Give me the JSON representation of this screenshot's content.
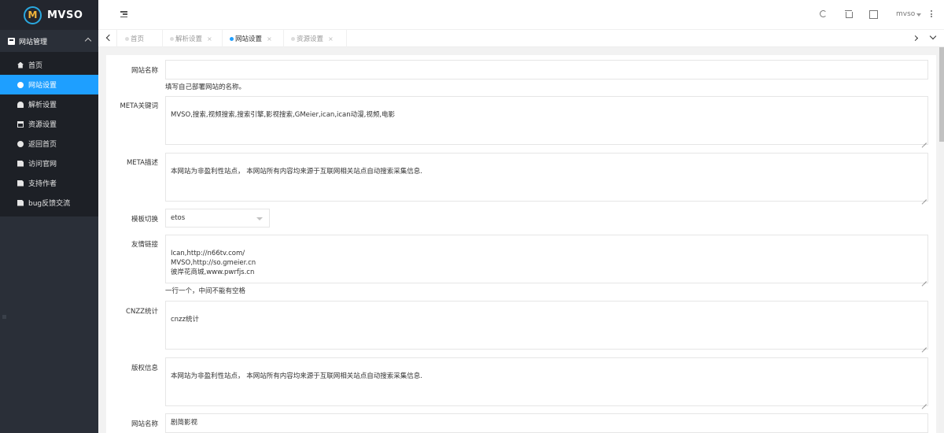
{
  "brand": {
    "logo_letter": "M",
    "name": "MVSO"
  },
  "sidebar": {
    "group": "网站管理",
    "items": [
      {
        "label": "首页",
        "icon": "home-icon"
      },
      {
        "label": "网站设置",
        "icon": "gear-icon",
        "active": true
      },
      {
        "label": "解析设置",
        "icon": "dashboard-icon"
      },
      {
        "label": "资源设置",
        "icon": "window-icon"
      },
      {
        "label": "返回首页",
        "icon": "cogs-icon"
      },
      {
        "label": "访问官网",
        "icon": "file-icon"
      },
      {
        "label": "支持作者",
        "icon": "file-icon"
      },
      {
        "label": "bug反馈交流",
        "icon": "file-icon"
      }
    ]
  },
  "header": {
    "user": "mvso"
  },
  "tabs": [
    {
      "label": "首页",
      "closable": false
    },
    {
      "label": "解析设置",
      "closable": true
    },
    {
      "label": "网站设置",
      "closable": true,
      "active": true
    },
    {
      "label": "资源设置",
      "closable": true
    }
  ],
  "tab_close_glyph": "×",
  "form": {
    "site_name": {
      "label": "网站名称",
      "value": "",
      "help": "填写自己部署网站的名称。"
    },
    "meta_keywords": {
      "label": "META关键词",
      "value": "MVSO,搜索,视频搜索,搜索引擎,影视搜索,GMeier,ican,ican动漫,视频,电影"
    },
    "meta_desc": {
      "label": "META描述",
      "value": "本网站为非盈利性站点， 本网站所有内容均来源于互联网相关站点自动搜索采集信息."
    },
    "template": {
      "label": "模板切换",
      "value": "etos"
    },
    "links": {
      "label": "友情链接",
      "value": "Ican,http://n66tv.com/\nMVSO,http://so.gmeier.cn\n彼岸花商城,www.pwrfjs.cn",
      "help": "一行一个，中间不能有空格"
    },
    "cnzz": {
      "label": "CNZZ统计",
      "value": "cnzz统计"
    },
    "copyright": {
      "label": "版权信息",
      "value": "本网站为非盈利性站点， 本网站所有内容均来源于互联网相关站点自动搜索采集信息."
    },
    "site_name2": {
      "label": "网站名称",
      "value": "剧简影视"
    }
  },
  "colors": {
    "sidebar": "#2a2f38",
    "active": "#1e9fff",
    "logo_ring": "#2aa8df",
    "logo_letter": "#f2b53a"
  }
}
